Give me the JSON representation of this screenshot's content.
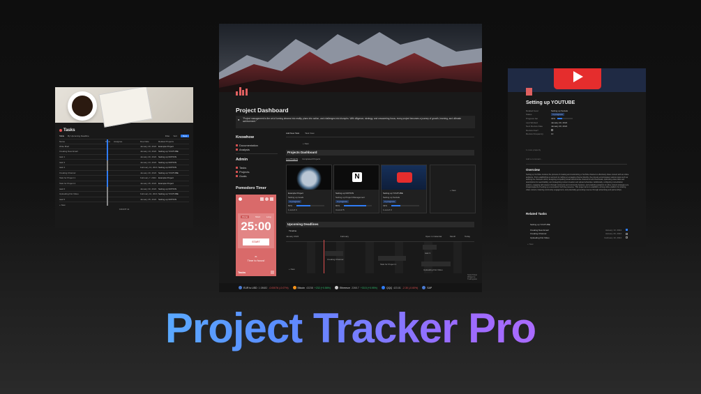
{
  "product_title": "Project Tracker Pro",
  "tasks_panel": {
    "title": "Tasks",
    "view_tabs": [
      "Table",
      "By Upcoming Deadline"
    ],
    "toolbar": [
      "Filter",
      "Sort",
      "New"
    ],
    "columns": [
      "Name",
      "Done",
      "Assignee",
      "Due Date",
      "Related Projects"
    ],
    "rows": [
      {
        "name": "Write Brief",
        "done": true,
        "due": "January 20, 2024",
        "project": "Example Project"
      },
      {
        "name": "Creating New Email",
        "done": true,
        "due": "January 13, 2024",
        "project": "Setting up YOUTUBE"
      },
      {
        "name": "task 1",
        "done": true,
        "due": "January 20, 2024",
        "project": "Setting up NOTION"
      },
      {
        "name": "task 3",
        "done": true,
        "due": "January 23, 2024",
        "project": "Setting up NOTION"
      },
      {
        "name": "task 4",
        "done": false,
        "due": "February 13, 2024",
        "project": "Setting up NOTION"
      },
      {
        "name": "Creating Channel",
        "done": false,
        "due": "January 20, 2024",
        "project": "Setting up YOUTUBE"
      },
      {
        "name": "Task for Project 1",
        "done": true,
        "due": "February 7, 2024",
        "project": "Example Project"
      },
      {
        "name": "Task for Project 4",
        "done": true,
        "due": "January 25, 2024",
        "project": "Example Project"
      },
      {
        "name": "task 6",
        "done": true,
        "due": "January 30, 2024",
        "project": "Setting up NOTION"
      },
      {
        "name": "Uploading first Video",
        "done": false,
        "due": "February 10, 2024",
        "project": "Setting up YOUTUBE"
      },
      {
        "name": "task 5",
        "done": false,
        "due": "January 25, 2024",
        "project": "Setting up NOTION"
      }
    ],
    "new_label": "+ New",
    "count_label": "COUNT 11"
  },
  "main_panel": {
    "title": "Project Dashboard",
    "quote": "\"Project management is the art of turning dreams into reality, plans into action, and challenges into triumphs. With diligence, strategy, and unwavering focus, every project becomes a journey of growth, learning, and ultimate achievement.\"",
    "knowhow": {
      "heading": "Knowhow",
      "items": [
        "Documentation",
        "Analysis"
      ]
    },
    "admin": {
      "heading": "Admin",
      "items": [
        "Tasks",
        "Projects",
        "Goals"
      ]
    },
    "pomodoro": {
      "heading": "Pomodoro Timer",
      "modes": [
        "Pomo",
        "Short",
        "Long"
      ],
      "time": "25:00",
      "start": "START",
      "session": "#1",
      "message": "Time to focus!",
      "tasks_label": "Tasks"
    },
    "actions": [
      "Add New Task",
      "Task View"
    ],
    "new_label": "+ New",
    "projects_heading": "Projects Dashboard",
    "project_tabs": [
      "Live Projects",
      "Completed Projects"
    ],
    "cards": [
      {
        "name": "Example Project",
        "sub": "Setting up Goals",
        "status": "In progress",
        "progress": "50%",
        "tasks": "1 out of 4"
      },
      {
        "name": "Setting up NOTION",
        "sub": "Setting up Project Management",
        "status": "In progress",
        "progress": "80%",
        "tasks": "4 out of 5"
      },
      {
        "name": "Setting up YOUTUBE",
        "sub": "Setting up Socials",
        "status": "In progress",
        "progress": "33%",
        "tasks": "1 out of 3"
      }
    ],
    "deadlines": {
      "heading": "Upcoming Deadlines",
      "view": "Timeline",
      "months": [
        "January 2024",
        "February"
      ],
      "open_calendar": "Open in Calendar",
      "range": "Month",
      "today": "Today",
      "items": [
        "Creating Channel",
        "Task for Project 1",
        "task 3",
        "Uploading first Video"
      ],
      "new": "+ New"
    },
    "ticker": [
      {
        "name": "EUR to USD",
        "value": "1.08682",
        "change": "-0.00076 (-0.07%)",
        "color": "#e05050"
      },
      {
        "name": "Bitcoin",
        "value": "43238",
        "change": "+232 (+0.56%)",
        "color": "#30c070"
      },
      {
        "name": "Ethereum",
        "value": "2265.7",
        "change": "+33.5 (+0.95%)",
        "color": "#30c070"
      },
      {
        "name": "QQQ",
        "value": "423.81",
        "change": "-2.30 (-0.60%)",
        "color": "#e05050"
      },
      {
        "name": "SAP",
        "value": "",
        "change": "",
        "color": "#e05050"
      }
    ],
    "widget_credit": "Stock Ticker Widget by Tradingview"
  },
  "yt_panel": {
    "title": "Setting up YOUTUBE",
    "props": [
      {
        "k": "Related Goal",
        "v": "Setting up Socials"
      },
      {
        "k": "Status",
        "v": "In progress"
      },
      {
        "k": "Progress bar",
        "v": "33%"
      },
      {
        "k": "Last Worked",
        "v": "January 20, 2024"
      },
      {
        "k": "Next Review Date",
        "v": "January 20, 2024"
      },
      {
        "k": "Review Due?",
        "v": ""
      },
      {
        "k": "Review Frequency",
        "v": "10"
      }
    ],
    "more": "1 more property",
    "comment": "Add a comment...",
    "overview_heading": "Overview",
    "overview": "Setting up YouTube involves the process of creating and customizing a YouTube channel to effectively share content with an online audience. From establishing an account to crafting an engaging channel identity, the process encompasses various steps such as defining the channel's niche, designing compelling visual elements like channel art and thumbnails, optimizing video titles and descriptions for searchability, and strategizing content creation and upload schedules. Additionally, configuring monetization options, engaging with viewers through comments and community features, and analyzing analytics to refine content strategies are integral aspects of setting up a successful YouTube presence. This project aims to establish a strong online platform for sharing video content, fostering community engagement, and potentially generating revenue through advertising and partnerships.",
    "related_heading": "Related Tasks",
    "related_group": "Setting up YOUTUBE",
    "related": [
      {
        "name": "Creating New Email",
        "due": "January 13, 2024",
        "done": true
      },
      {
        "name": "Creating Channel",
        "due": "January 20, 2024",
        "done": false
      },
      {
        "name": "Uploading first Video",
        "due": "February 10, 2024",
        "done": false
      }
    ],
    "new": "+ New"
  }
}
